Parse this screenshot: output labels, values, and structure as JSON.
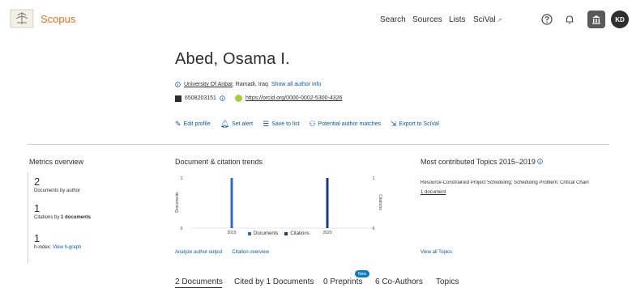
{
  "header": {
    "brand": "Scopus",
    "nav": {
      "search": "Search",
      "sources": "Sources",
      "lists": "Lists",
      "scival": "SciVal",
      "scival_ext": "↗"
    },
    "avatar_initials": "KD"
  },
  "author": {
    "name": "Abed, Osama I.",
    "affiliation": "University Of Anbar",
    "location": ", Ramadi, Iraq",
    "show_all": "Show all author info",
    "scopus_id": "6508203151",
    "orcid": "https://orcid.org/0000-0002-5300-4326"
  },
  "actions": {
    "edit": "Edit profile",
    "alert": "Set alert",
    "save": "Save to list",
    "matches": "Potential author matches",
    "export": "Export to SciVal"
  },
  "metrics": {
    "title": "Metrics overview",
    "docs_value": "2",
    "docs_label": "Documents by author",
    "cit_value": "1",
    "cit_label_prefix": "Citations by ",
    "cit_label_bold": "1 documents",
    "h_value": "1",
    "h_label": "h-index:",
    "h_link": "View h-graph"
  },
  "trends": {
    "title": "Document & citation trends",
    "analyze": "Analyze author output",
    "citation_overview": "Citation overview"
  },
  "chart_data": {
    "type": "bar",
    "categories": [
      "2019",
      "2020"
    ],
    "series": [
      {
        "name": "Documents",
        "values": [
          1,
          0
        ],
        "color": "#2f6bc9"
      },
      {
        "name": "Citations",
        "values": [
          0,
          1
        ],
        "color": "#1f3b7a"
      }
    ],
    "ylabel": "Documents",
    "y2label": "Citations",
    "ylim": [
      0,
      1
    ],
    "y_ticks": [
      "0",
      "1"
    ],
    "y2_ticks": [
      "0",
      "1"
    ],
    "legend_position": "bottom"
  },
  "topics": {
    "title": "Most contributed Topics 2015–2019",
    "topic": "Resource-Constrained Project Scheduling; Scheduling Problem; Critical Chain",
    "docs": "1 document",
    "view_all": "View all Topics"
  },
  "tabs": {
    "docs": "2 Documents",
    "cited": "Cited by 1 Documents",
    "preprints": "0 Preprints",
    "new_badge": "New",
    "coauthors": "6 Co-Authors",
    "topics": "Topics"
  }
}
